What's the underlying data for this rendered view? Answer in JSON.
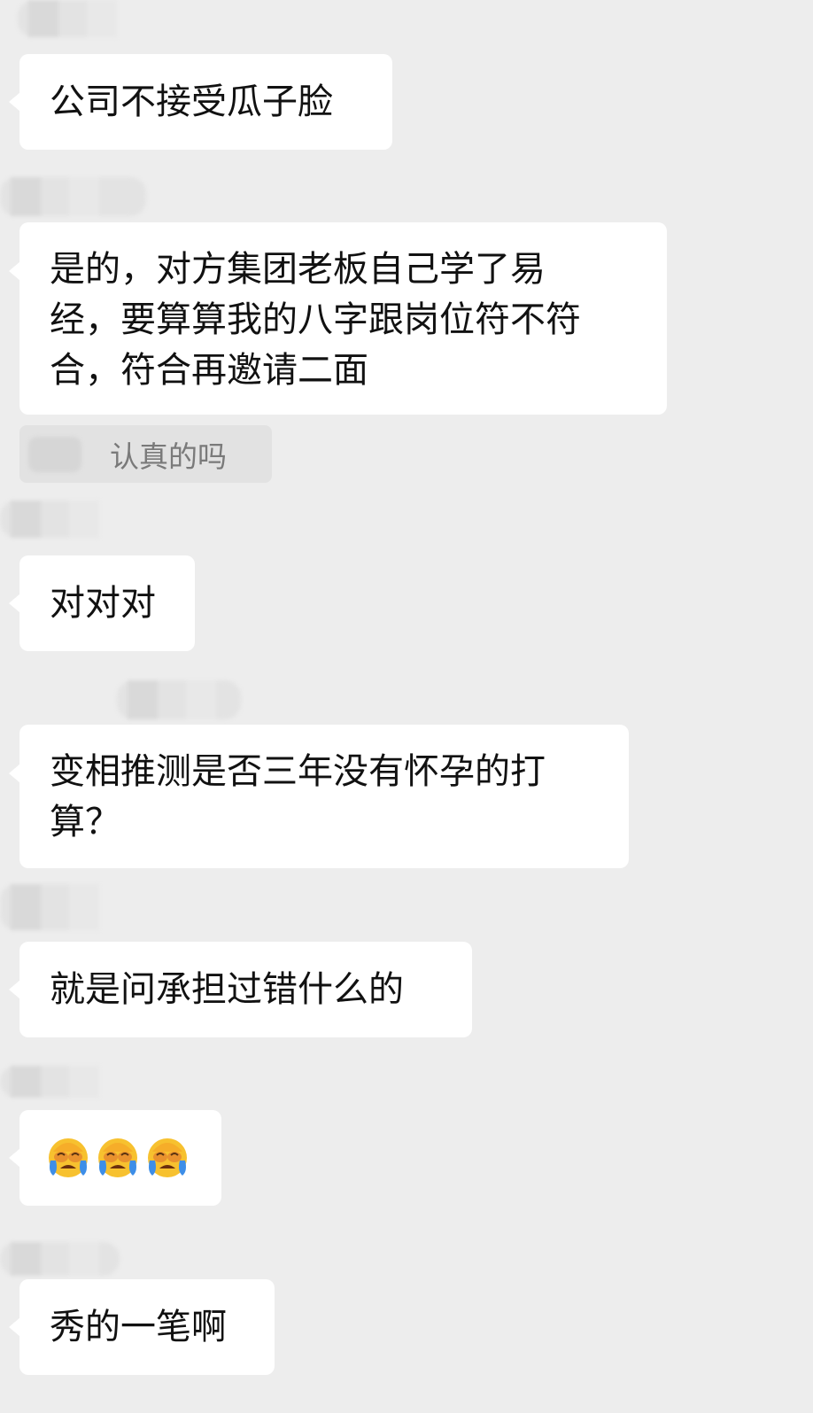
{
  "messages": [
    {
      "text": "公司不接受瓜子脸"
    },
    {
      "lines": [
        "是的，对方集团老板自己学了易",
        "经，要算算我的八字跟岗位符不符",
        "合，符合再邀请二面"
      ]
    },
    {
      "quote": "认真的吗"
    },
    {
      "text": "对对对"
    },
    {
      "lines": [
        "变相推测是否三年没有怀孕的打",
        "算？"
      ]
    },
    {
      "text": "就是问承担过错什么的"
    },
    {
      "emojis": [
        "crying-face",
        "crying-face",
        "crying-face"
      ]
    },
    {
      "text": "秀的一笔啊"
    }
  ],
  "colors": {
    "background": "#ededed",
    "bubble": "#ffffff",
    "quote_bg": "#e2e2e2",
    "quote_text": "#7a7a7a",
    "text": "#111111"
  }
}
